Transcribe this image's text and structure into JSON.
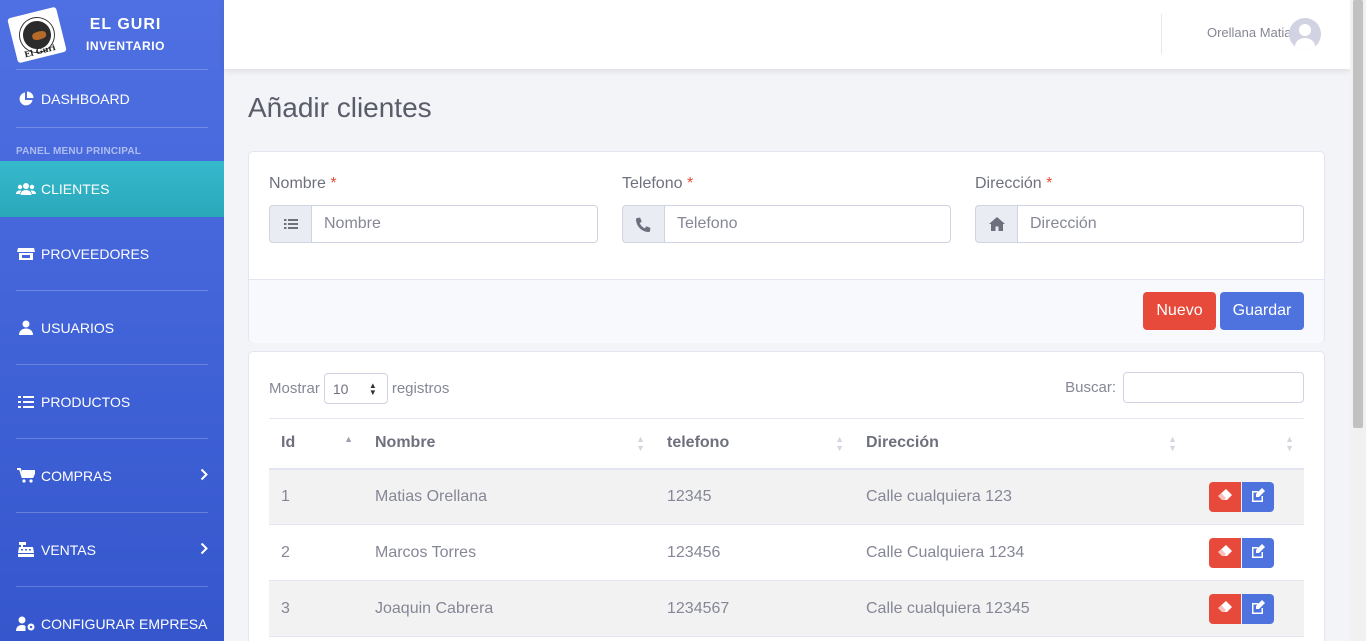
{
  "brand": {
    "title": "EL GURI",
    "subtitle": "INVENTARIO",
    "logo_text": "El Guri"
  },
  "sidebar": {
    "dashboard": "DASHBOARD",
    "heading": "PANEL MENU PRINCIPAL",
    "items": [
      {
        "label": "CLIENTES",
        "icon": "users-icon"
      },
      {
        "label": "PROVEEDORES",
        "icon": "store-icon"
      },
      {
        "label": "USUARIOS",
        "icon": "user-icon"
      },
      {
        "label": "PRODUCTOS",
        "icon": "list-icon"
      },
      {
        "label": "COMPRAS",
        "icon": "cart-icon"
      },
      {
        "label": "VENTAS",
        "icon": "cash-register-icon"
      },
      {
        "label": "CONFIGURAR EMPRESA",
        "icon": "user-cog-icon"
      }
    ]
  },
  "topbar": {
    "user_name": "Orellana Matias"
  },
  "page": {
    "title": "Añadir clientes"
  },
  "form": {
    "nombre": {
      "label": "Nombre",
      "placeholder": "Nombre"
    },
    "telefono": {
      "label": "Telefono",
      "placeholder": "Telefono"
    },
    "direccion": {
      "label": "Dirección",
      "placeholder": "Dirección"
    },
    "required_mark": "*",
    "btn_nuevo": "Nuevo",
    "btn_guardar": "Guardar"
  },
  "table": {
    "show_label": "Mostrar",
    "show_value": "10",
    "records_label": "registros",
    "search_label": "Buscar:",
    "columns": [
      "Id",
      "Nombre",
      "telefono",
      "Dirección"
    ],
    "rows": [
      {
        "id": "1",
        "nombre": "Matias Orellana",
        "telefono": "12345",
        "direccion": "Calle cualquiera 123"
      },
      {
        "id": "2",
        "nombre": "Marcos Torres",
        "telefono": "123456",
        "direccion": "Calle Cualquiera 1234"
      },
      {
        "id": "3",
        "nombre": "Joaquin Cabrera",
        "telefono": "1234567",
        "direccion": "Calle cualquiera 12345"
      }
    ]
  },
  "colors": {
    "primary": "#4e73df",
    "danger": "#e74a3b",
    "info": "#36b9cc"
  }
}
